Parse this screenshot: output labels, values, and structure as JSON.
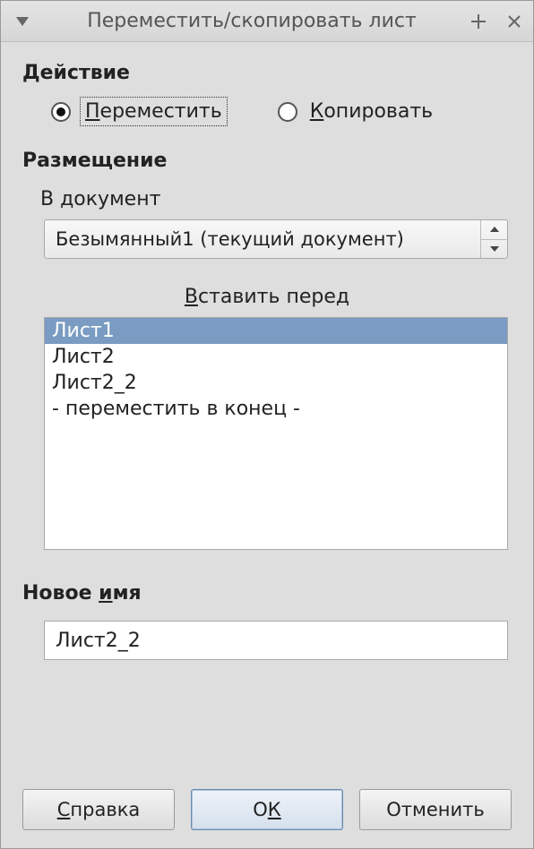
{
  "window": {
    "title": "Переместить/скопировать лист"
  },
  "action": {
    "heading": "Действие",
    "move_label_pre": "",
    "move_mnemonic": "П",
    "move_label_post": "ереместить",
    "copy_mnemonic": "К",
    "copy_label_post": "опировать",
    "selected": "move"
  },
  "placement": {
    "heading": "Размещение",
    "doc_label": "В документ",
    "doc_value": "Безымянный1 (текущий документ)",
    "insert_before_pre": "",
    "insert_before_mnemonic": "В",
    "insert_before_post": "ставить перед",
    "items": [
      "Лист1",
      "Лист2",
      "Лист2_2",
      "- переместить в конец -"
    ],
    "selected_index": 0
  },
  "new_name": {
    "heading_pre": "Новое ",
    "heading_mnemonic": "и",
    "heading_post": "мя",
    "value": "Лист2_2"
  },
  "buttons": {
    "help_mnemonic": "С",
    "help_post": "правка",
    "ok_pre": "О",
    "ok_mnemonic": "К",
    "cancel": "Отменить"
  }
}
